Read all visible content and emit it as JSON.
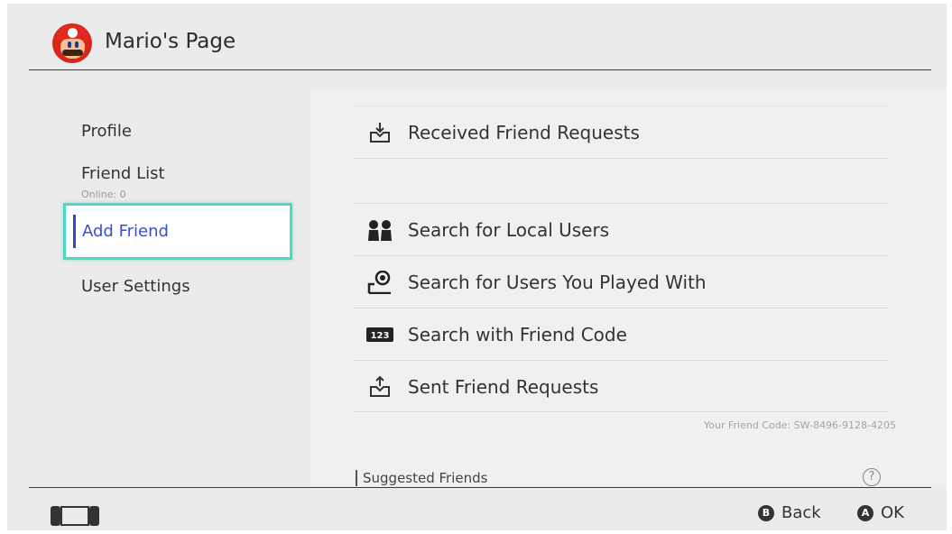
{
  "header": {
    "title": "Mario's Page",
    "avatar_icon": "mario-avatar"
  },
  "sidebar": {
    "items": [
      {
        "label": "Profile"
      },
      {
        "label": "Friend List",
        "sub": "Online: 0"
      },
      {
        "label": "Add Friend",
        "selected": true
      },
      {
        "label": "User Settings"
      }
    ]
  },
  "main": {
    "rows": [
      {
        "label": "Received Friend Requests",
        "icon": "inbox-download-icon"
      },
      {
        "label": "Search for Local Users",
        "icon": "local-users-icon"
      },
      {
        "label": "Search for Users You Played With",
        "icon": "played-with-icon"
      },
      {
        "label": "Search with Friend Code",
        "icon": "friend-code-icon"
      },
      {
        "label": "Sent Friend Requests",
        "icon": "inbox-upload-icon"
      }
    ],
    "friend_code_text": "Your Friend Code: SW-8496-9128-4205",
    "suggested_label": "Suggested Friends",
    "help_glyph": "?"
  },
  "footer": {
    "back": {
      "glyph": "B",
      "label": "Back"
    },
    "ok": {
      "glyph": "A",
      "label": "OK"
    }
  },
  "colors": {
    "selection_border": "#4fd8c8",
    "selected_text": "#3450d6",
    "background": "#ebebeb"
  }
}
